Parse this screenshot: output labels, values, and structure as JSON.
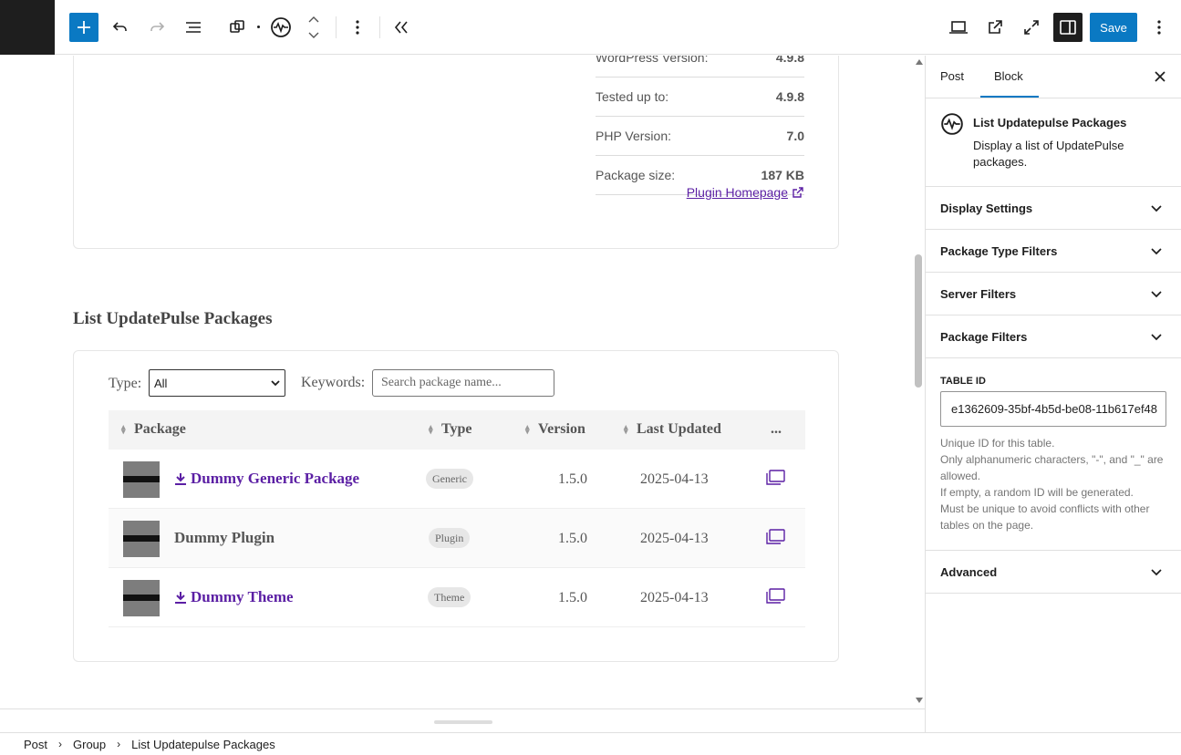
{
  "toolbar": {
    "save_label": "Save",
    "colors": {
      "accent": "#0a79c3",
      "dark": "#1e1e1e"
    }
  },
  "plugin_meta": {
    "rows": [
      {
        "label": "WordPress Version:",
        "value": "4.9.8"
      },
      {
        "label": "Tested up to:",
        "value": "4.9.8"
      },
      {
        "label": "PHP Version:",
        "value": "7.0"
      },
      {
        "label": "Package size:",
        "value": "187 KB"
      }
    ],
    "homepage_link": "Plugin Homepage"
  },
  "list_block": {
    "title": "List UpdatePulse Packages",
    "type_label": "Type:",
    "type_selected": "All",
    "keywords_label": "Keywords:",
    "search_placeholder": "Search package name...",
    "columns": {
      "package": "Package",
      "type": "Type",
      "version": "Version",
      "last_updated": "Last Updated",
      "more": "..."
    },
    "rows": [
      {
        "name": "Dummy Generic Package",
        "type": "Generic",
        "version": "1.5.0",
        "updated": "2025-04-13",
        "download": true
      },
      {
        "name": "Dummy Plugin",
        "type": "Plugin",
        "version": "1.5.0",
        "updated": "2025-04-13",
        "download": false
      },
      {
        "name": "Dummy Theme",
        "type": "Theme",
        "version": "1.5.0",
        "updated": "2025-04-13",
        "download": true
      }
    ]
  },
  "sidebar": {
    "tabs": [
      "Post",
      "Block"
    ],
    "block": {
      "title": "List Updatepulse Packages",
      "description": "Display a list of UpdatePulse packages."
    },
    "panels": [
      "Display Settings",
      "Package Type Filters",
      "Server Filters",
      "Package Filters"
    ],
    "table_id": {
      "label": "TABLE ID",
      "value": "e1362609-35bf-4b5d-be08-11b617ef48",
      "help": [
        "Unique ID for this table.",
        "Only alphanumeric characters, \"-\", and \"_\" are allowed.",
        "If empty, a random ID will be generated.",
        "Must be unique to avoid conflicts with other tables on the page."
      ]
    },
    "advanced": "Advanced"
  },
  "breadcrumb": [
    "Post",
    "Group",
    "List Updatepulse Packages"
  ]
}
